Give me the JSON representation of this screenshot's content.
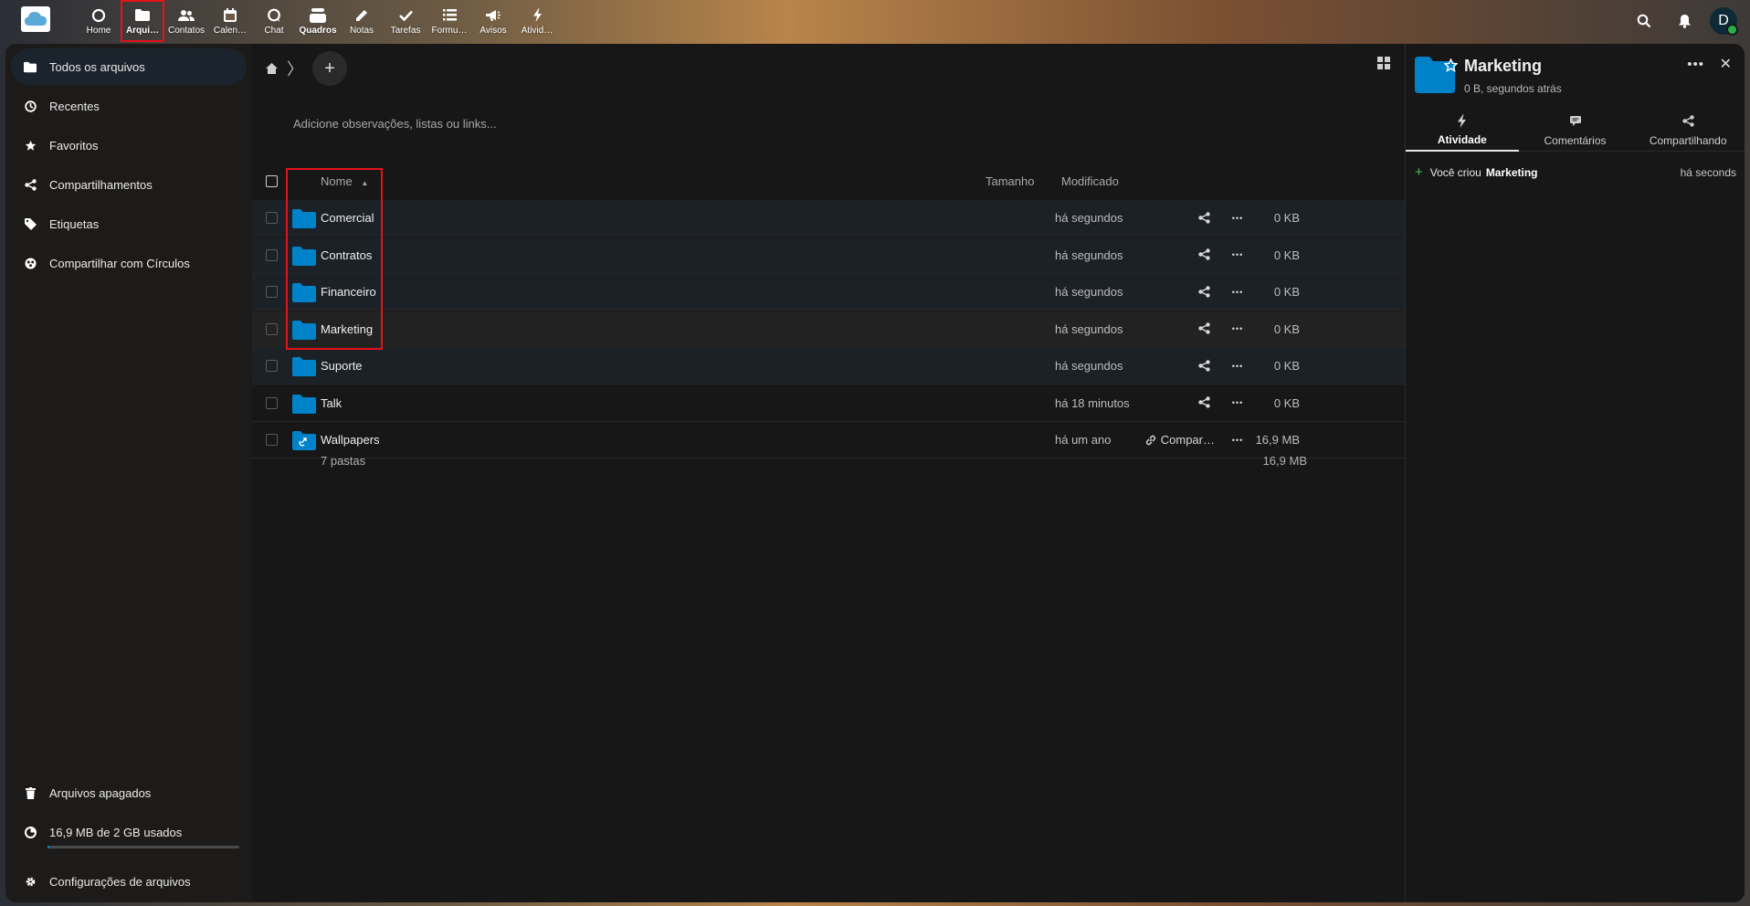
{
  "header": {
    "apps": [
      {
        "label": "Home",
        "icon": "home-circle-icon"
      },
      {
        "label": "Arqui…",
        "icon": "folder-icon",
        "active": true
      },
      {
        "label": "Contatos",
        "icon": "contacts-icon"
      },
      {
        "label": "Calen…",
        "icon": "calendar-icon"
      },
      {
        "label": "Chat",
        "icon": "chat-icon"
      },
      {
        "label": "Quadros",
        "icon": "deck-icon",
        "bold": true
      },
      {
        "label": "Notas",
        "icon": "pencil-icon"
      },
      {
        "label": "Tarefas",
        "icon": "checkmark-icon"
      },
      {
        "label": "Formu…",
        "icon": "forms-list-icon"
      },
      {
        "label": "Avisos",
        "icon": "megaphone-icon"
      },
      {
        "label": "Ativid…",
        "icon": "lightning-icon"
      }
    ],
    "avatar_initial": "D"
  },
  "sidebar": {
    "items": [
      {
        "label": "Todos os arquivos",
        "icon": "folder-icon",
        "active": true
      },
      {
        "label": "Recentes",
        "icon": "clock-icon"
      },
      {
        "label": "Favoritos",
        "icon": "star-icon"
      },
      {
        "label": "Compartilhamentos",
        "icon": "share-icon"
      },
      {
        "label": "Etiquetas",
        "icon": "tag-icon"
      },
      {
        "label": "Compartilhar com Círculos",
        "icon": "circles-icon"
      }
    ],
    "trash_label": "Arquivos apagados",
    "quota_label": "16,9 MB de 2 GB usados",
    "quota_fraction": 0.008,
    "settings_label": "Configurações de arquivos"
  },
  "files": {
    "notes_placeholder": "Adicione observações, listas ou links...",
    "columns": {
      "name": "Nome",
      "size": "Tamanho",
      "modified": "Modificado"
    },
    "rows": [
      {
        "name": "Comercial",
        "size": "0 KB",
        "modified": "há segundos",
        "state": "sel"
      },
      {
        "name": "Contratos",
        "size": "0 KB",
        "modified": "há segundos",
        "state": "sel"
      },
      {
        "name": "Financeiro",
        "size": "0 KB",
        "modified": "há segundos",
        "state": "sel"
      },
      {
        "name": "Marketing",
        "size": "0 KB",
        "modified": "há segundos",
        "state": "hl"
      },
      {
        "name": "Suporte",
        "size": "0 KB",
        "modified": "há segundos",
        "state": "sel"
      },
      {
        "name": "Talk",
        "size": "0 KB",
        "modified": "há 18 minutos",
        "state": ""
      },
      {
        "name": "Wallpapers",
        "size": "16,9 MB",
        "modified": "há um ano",
        "state": "",
        "shared": true,
        "share_label": "Compar…"
      }
    ],
    "summary_count": "7 pastas",
    "summary_size": "16,9 MB"
  },
  "details": {
    "title": "Marketing",
    "subtitle": "0 B, segundos atrás",
    "tabs": [
      {
        "label": "Atividade",
        "icon": "lightning-icon",
        "active": true
      },
      {
        "label": "Comentários",
        "icon": "comment-icon"
      },
      {
        "label": "Compartilhando",
        "icon": "share-icon"
      }
    ],
    "activity": {
      "text": "Você criou",
      "object": "Marketing",
      "time": "há seconds"
    }
  },
  "colors": {
    "accent": "#0082c9",
    "folder": "#0082c9",
    "highlight_box": "#e3121b"
  }
}
